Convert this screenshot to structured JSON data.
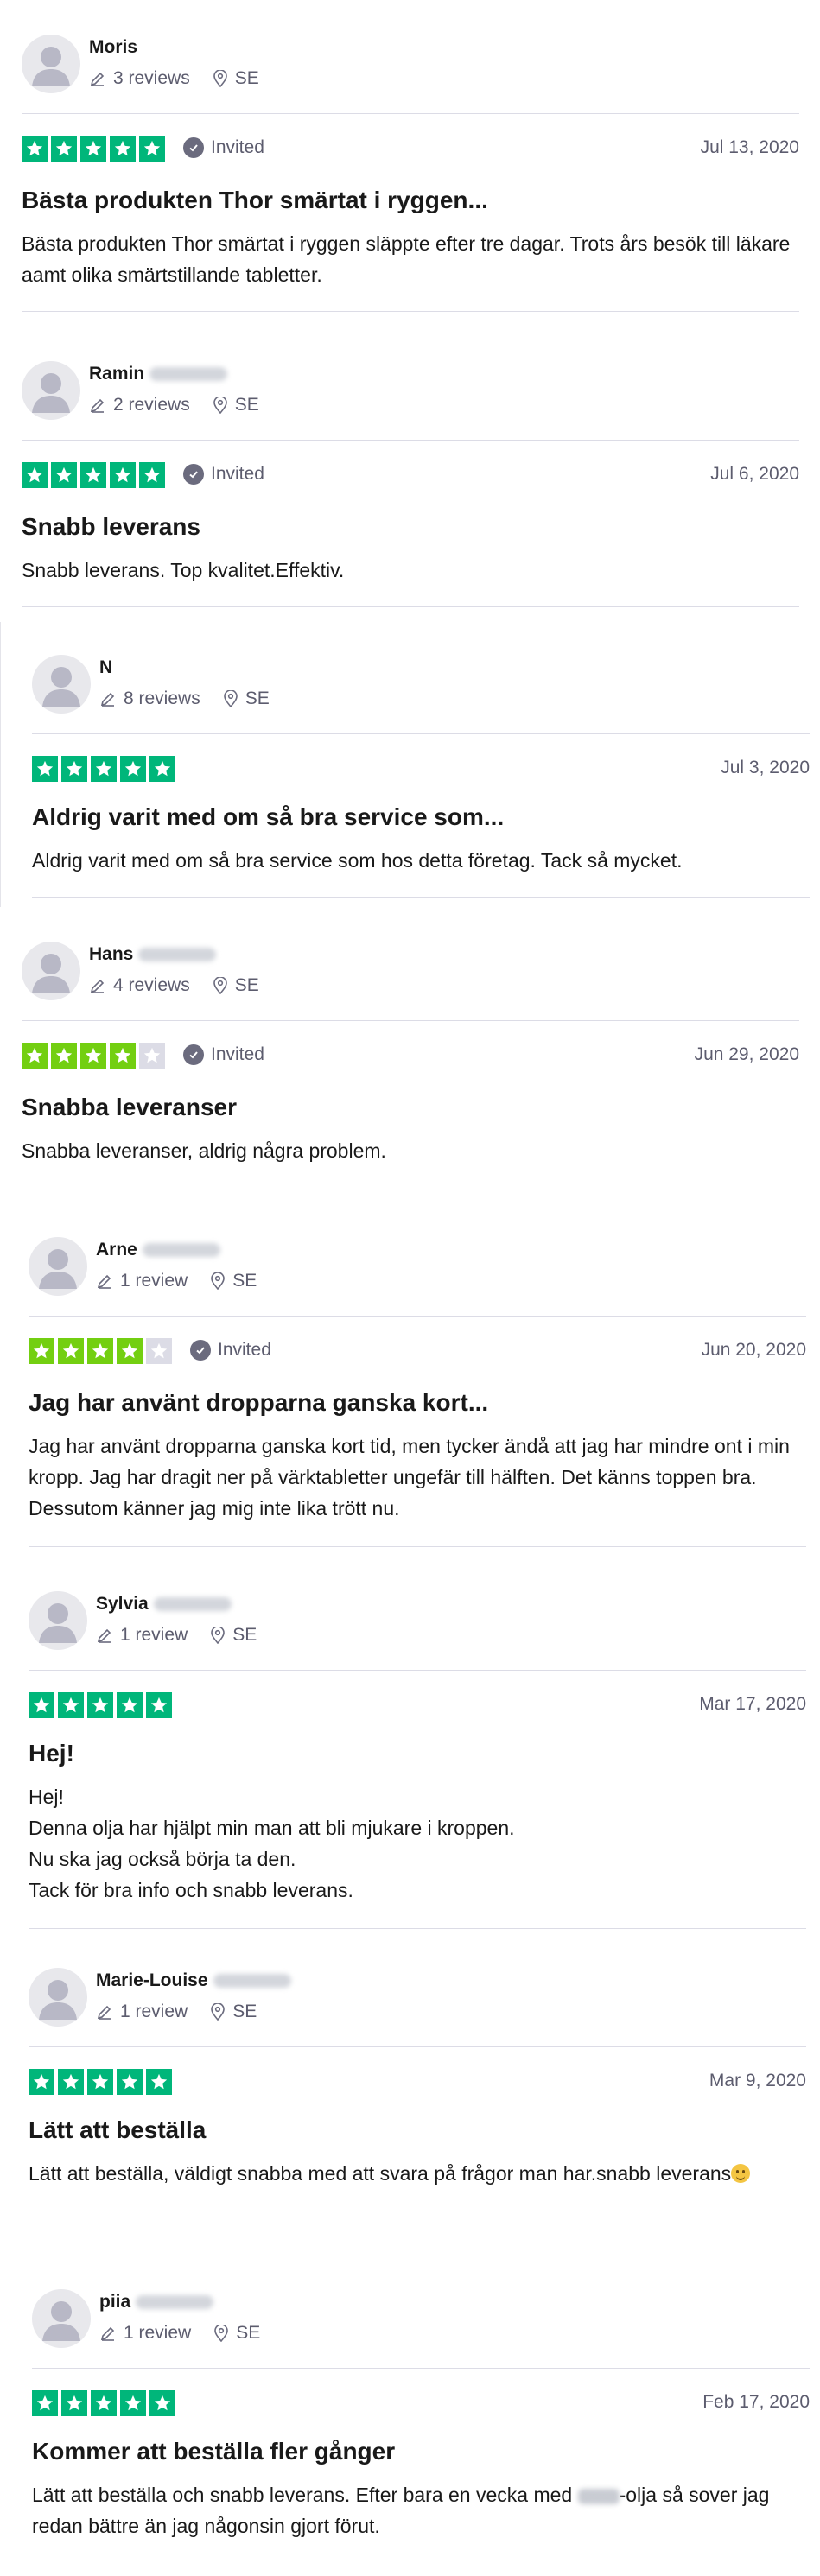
{
  "labels": {
    "invited": "Invited"
  },
  "colors": {
    "star_five": "#00b67a",
    "star_four": "#73cf11",
    "star_empty": "#dcdce6",
    "text_muted": "#5c5c6e",
    "divider": "#dcdce6"
  },
  "icons": {
    "reviews": "pencil-icon",
    "location": "location-pin-icon",
    "invited": "check-circle-icon",
    "star": "star-icon",
    "avatar": "user-silhouette-icon"
  },
  "reviews": [
    {
      "name": "Moris",
      "reviews_count": "3 reviews",
      "country": "SE",
      "rating": 5,
      "invited": true,
      "date": "Jul 13, 2020",
      "title": "Bästa produkten Thor smärtat i ryggen...",
      "body": [
        "Bästa produkten Thor smärtat i ryggen släppte efter tre dagar. Trots års besök till läkare aamt olika smärtstillande tabletter."
      ]
    },
    {
      "name": "Ramin",
      "reviews_count": "2 reviews",
      "country": "SE",
      "rating": 5,
      "invited": true,
      "date": "Jul 6, 2020",
      "title": "Snabb leverans",
      "body": [
        "Snabb leverans. Top kvalitet.Effektiv."
      ]
    },
    {
      "name": "N",
      "reviews_count": "8 reviews",
      "country": "SE",
      "rating": 5,
      "invited": false,
      "date": "Jul 3, 2020",
      "title": "Aldrig varit med om så bra service som...",
      "body": [
        "Aldrig varit med om så bra service som hos detta företag. Tack så mycket."
      ]
    },
    {
      "name": "Hans",
      "reviews_count": "4 reviews",
      "country": "SE",
      "rating": 4,
      "invited": true,
      "date": "Jun 29, 2020",
      "title": "Snabba leveranser",
      "body": [
        "Snabba leveranser, aldrig några problem."
      ]
    },
    {
      "name": "Arne",
      "reviews_count": "1 review",
      "country": "SE",
      "rating": 4,
      "invited": true,
      "date": "Jun 20, 2020",
      "title": "Jag har använt dropparna ganska kort...",
      "body": [
        "Jag har använt dropparna ganska kort tid, men tycker ändå att jag har mindre ont i min kropp. Jag har dragit ner på värktabletter ungefär till hälften. Det känns toppen bra. Dessutom känner jag mig inte lika trött nu."
      ]
    },
    {
      "name": "Sylvia",
      "reviews_count": "1 review",
      "country": "SE",
      "rating": 5,
      "invited": false,
      "date": "Mar 17, 2020",
      "title": "Hej!",
      "body": [
        "Hej!",
        "Denna olja har hjälpt min man att bli mjukare i kroppen.",
        "Nu ska jag också börja ta den.",
        "Tack för bra info och snabb leverans."
      ]
    },
    {
      "name": "Marie-Louise",
      "reviews_count": "1 review",
      "country": "SE",
      "rating": 5,
      "invited": false,
      "date": "Mar 9, 2020",
      "title": "Lätt att beställa",
      "body": [
        "Lätt att beställa, väldigt snabba med att svara på frågor man har.snabb leverans"
      ]
    },
    {
      "name": "piia",
      "reviews_count": "1 review",
      "country": "SE",
      "rating": 5,
      "invited": false,
      "date": "Feb 17, 2020",
      "title": "Kommer att beställa fler gånger",
      "body_before": "Lätt att beställa och snabb leverans. Efter bara en vecka med ",
      "body_after": "-olja så sover jag redan bättre än jag någonsin gjort förut."
    }
  ]
}
